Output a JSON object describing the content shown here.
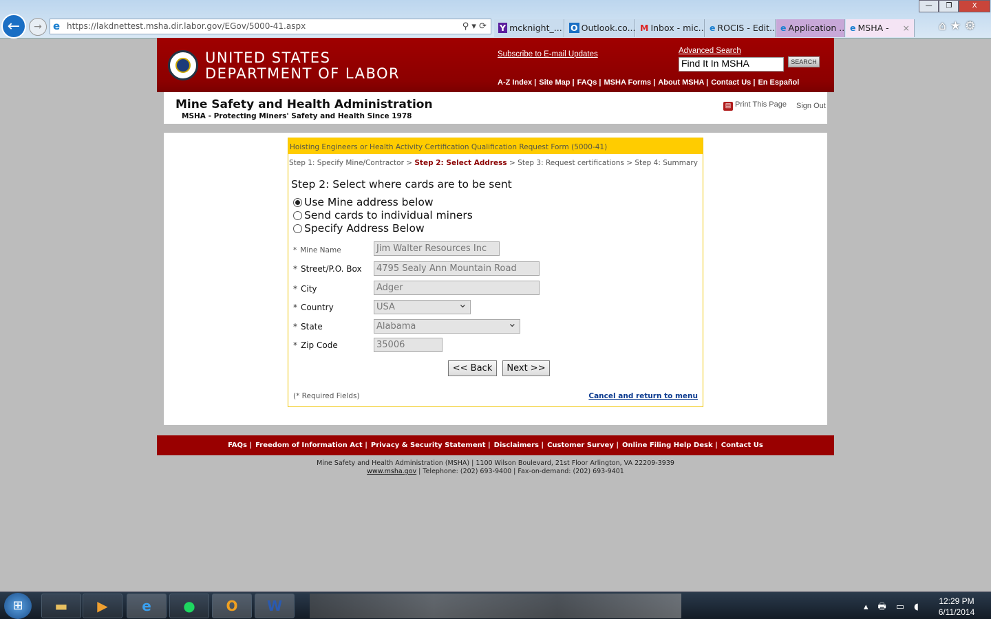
{
  "browser": {
    "url": "https://lakdnettest.msha.dir.labor.gov/EGov/5000-41.aspx",
    "tabs": [
      {
        "label": "mcknight_...",
        "icon": "Y"
      },
      {
        "label": "Outlook.co...",
        "icon": "O"
      },
      {
        "label": "Inbox - mic...",
        "icon": "M"
      },
      {
        "label": "ROCIS - Edit...",
        "icon": "e"
      },
      {
        "label": "Application ...",
        "icon": "e"
      },
      {
        "label": "MSHA -",
        "icon": "e"
      }
    ],
    "close_tab": "×",
    "window_controls": [
      "—",
      "❐",
      "X"
    ],
    "nav_icons": "⌂★⚙"
  },
  "header": {
    "line1": "UNITED STATES",
    "line2": "DEPARTMENT OF LABOR",
    "subscribe": "Subscribe to E-mail Updates",
    "advanced_search": "Advanced Search",
    "search_value": "Find It In MSHA",
    "search_button": "SEARCH",
    "links": [
      "A-Z Index |",
      "Site Map |",
      "FAQs |",
      "MSHA Forms |",
      "About MSHA |",
      "Contact Us |",
      "En Español"
    ]
  },
  "band": {
    "agency": "Mine Safety and Health Administration",
    "tagline": "MSHA - Protecting Miners' Safety and Health Since 1978",
    "print": "Print This Page",
    "signout": "Sign Out"
  },
  "form": {
    "title": "Hoisting Engineers or Health Activity Certification Qualification Request Form (5000-41)",
    "steps": {
      "s1": "Step 1: Specify Mine/Contractor",
      "sep": " > ",
      "s2": "Step 2: Select Address",
      "s3": "Step 3: Request certifications",
      "s4": "Step 4: Summary"
    },
    "heading": "Step 2: Select where cards are to be sent",
    "options": [
      {
        "label": "Use Mine address below",
        "selected": true
      },
      {
        "label": "Send cards to individual miners",
        "selected": false
      },
      {
        "label": "Specify Address Below",
        "selected": false
      }
    ],
    "fields": [
      {
        "label": "Mine Name",
        "value": "Jim Walter Resources Inc"
      },
      {
        "label": "Street/P.O. Box",
        "value": "4795 Sealy Ann Mountain Road"
      },
      {
        "label": "City",
        "value": "Adger"
      },
      {
        "label": "Country",
        "value": "USA"
      },
      {
        "label": "State",
        "value": "Alabama"
      },
      {
        "label": "Zip Code",
        "value": "35006"
      }
    ],
    "required_mark": "*",
    "back": "<< Back",
    "next": "Next >>",
    "required_note": "(* Required Fields)",
    "cancel": "Cancel and return to menu"
  },
  "footer": {
    "links": [
      "FAQs |",
      "Freedom of Information Act |",
      "Privacy & Security Statement |",
      "Disclaimers |",
      "Customer Survey |",
      "Online Filing Help Desk |",
      "Contact Us"
    ],
    "address": "Mine Safety and Health Administration (MSHA) | 1100 Wilson Boulevard, 21st Floor Arlington, VA 22209-3939",
    "site": "www.msha.gov",
    "contact": " | Telephone: (202) 693-9400 | Fax-on-demand: (202) 693-9401"
  },
  "taskbar": {
    "time": "12:29 PM",
    "date": "6/11/2014"
  },
  "colors": {
    "header_red": "#990000",
    "form_yellow": "#ffcc00",
    "step_active": "#8b0000"
  }
}
